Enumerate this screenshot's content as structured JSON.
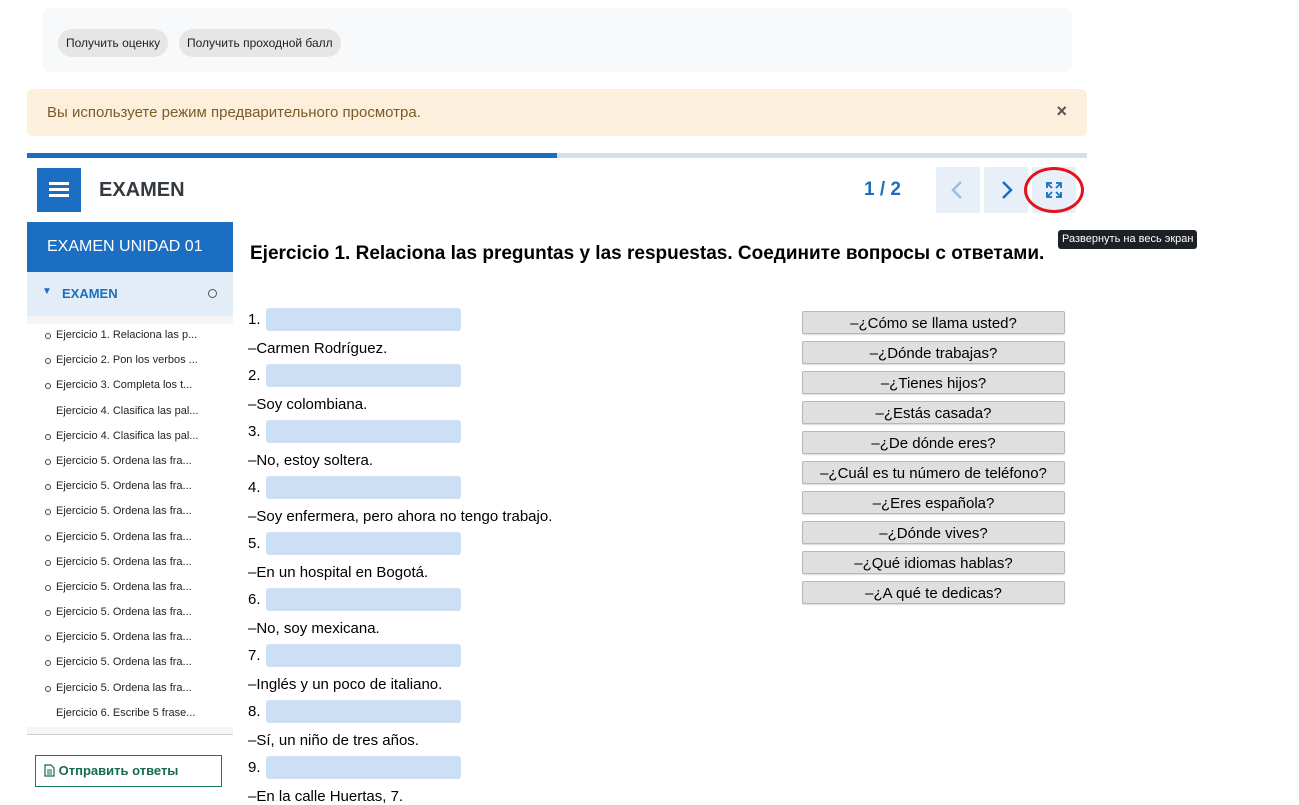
{
  "top_buttons": {
    "get_grade": "Получить оценку",
    "get_passing": "Получить проходной балл"
  },
  "alert": {
    "message": "Вы используете режим предварительного просмотра.",
    "close": "×"
  },
  "progress": {
    "fraction": 0.5
  },
  "header": {
    "title": "EXAMEN",
    "page": "1 / 2",
    "fullscreen_tooltip": "Развернуть на весь экран"
  },
  "sidebar": {
    "heading": "EXAMEN UNIDAD 01",
    "section": "EXAMEN",
    "items": [
      {
        "label": "Ejercicio 1. Relaciona las p...",
        "dot": true
      },
      {
        "label": "Ejercicio 2. Pon los verbos ...",
        "dot": true
      },
      {
        "label": "Ejercicio 3. Completa los t...",
        "dot": true
      },
      {
        "label": "Ejercicio 4. Clasifica las pal...",
        "dot": false
      },
      {
        "label": "Ejercicio 4. Clasifica las pal...",
        "dot": true
      },
      {
        "label": "Ejercicio 5. Ordena las fra...",
        "dot": true
      },
      {
        "label": "Ejercicio 5. Ordena las fra...",
        "dot": true
      },
      {
        "label": "Ejercicio 5. Ordena las fra...",
        "dot": true
      },
      {
        "label": "Ejercicio 5. Ordena las fra...",
        "dot": true
      },
      {
        "label": "Ejercicio 5. Ordena las fra...",
        "dot": true
      },
      {
        "label": "Ejercicio 5. Ordena las fra...",
        "dot": true
      },
      {
        "label": "Ejercicio 5. Ordena las fra...",
        "dot": true
      },
      {
        "label": "Ejercicio 5. Ordena las fra...",
        "dot": true
      },
      {
        "label": "Ejercicio 5. Ordena las fra...",
        "dot": true
      },
      {
        "label": "Ejercicio 5. Ordena las fra...",
        "dot": true
      },
      {
        "label": "Ejercicio 6. Escribe 5 frase...",
        "dot": false
      }
    ],
    "submit": "Отправить ответы"
  },
  "exercise": {
    "title": "Ejercicio 1. Relaciona las preguntas y las respuestas. Соедините вопросы с ответами.",
    "questions": [
      {
        "num": "1.",
        "answer": "–Carmen Rodríguez."
      },
      {
        "num": "2.",
        "answer": "–Soy colombiana."
      },
      {
        "num": "3.",
        "answer": "–No, estoy soltera."
      },
      {
        "num": "4.",
        "answer": "–Soy enfermera, pero ahora no tengo trabajo."
      },
      {
        "num": "5.",
        "answer": "–En un hospital en Bogotá."
      },
      {
        "num": "6.",
        "answer": "–No, soy mexicana."
      },
      {
        "num": "7.",
        "answer": "–Inglés y un poco de italiano."
      },
      {
        "num": "8.",
        "answer": "–Sí, un niño de tres años."
      },
      {
        "num": "9.",
        "answer": "–En la calle Huertas, 7."
      }
    ],
    "options": [
      "–¿Cómo se llama usted?",
      "–¿Dónde trabajas?",
      "–¿Tienes hijos?",
      "–¿Estás casada?",
      "–¿De dónde eres?",
      "–¿Cuál es tu número de teléfono?",
      "–¿Eres española?",
      "–¿Dónde vives?",
      "–¿Qué idiomas hablas?",
      "–¿A qué te dedicas?"
    ]
  }
}
